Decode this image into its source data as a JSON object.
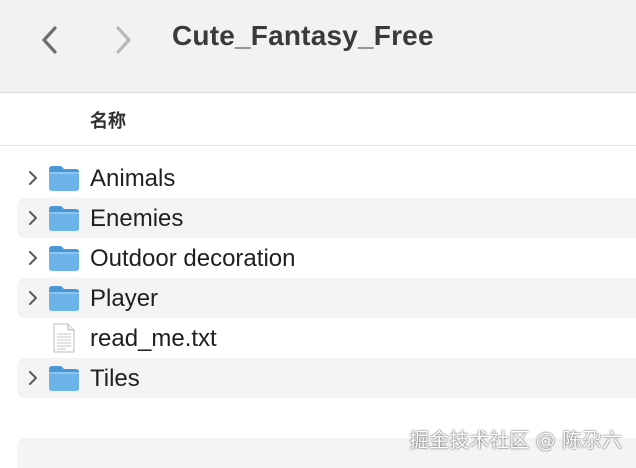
{
  "window": {
    "title": "Cute_Fantasy_Free"
  },
  "toolbar": {
    "back_icon": "chevron-left-icon",
    "forward_icon": "chevron-right-icon"
  },
  "columns": {
    "name_header": "名称"
  },
  "items": [
    {
      "name": "Animals",
      "kind": "folder"
    },
    {
      "name": "Enemies",
      "kind": "folder"
    },
    {
      "name": "Outdoor decoration",
      "kind": "folder"
    },
    {
      "name": "Player",
      "kind": "folder"
    },
    {
      "name": "read_me.txt",
      "kind": "file"
    },
    {
      "name": "Tiles",
      "kind": "folder"
    }
  ],
  "watermark": "掘金技术社区 @ 陈尕六",
  "colors": {
    "folder": "#6cb3ea",
    "folder_dark": "#4b97d6",
    "toolbar_bg": "#f2f2f2",
    "alt_row_bg": "#f4f4f4"
  }
}
